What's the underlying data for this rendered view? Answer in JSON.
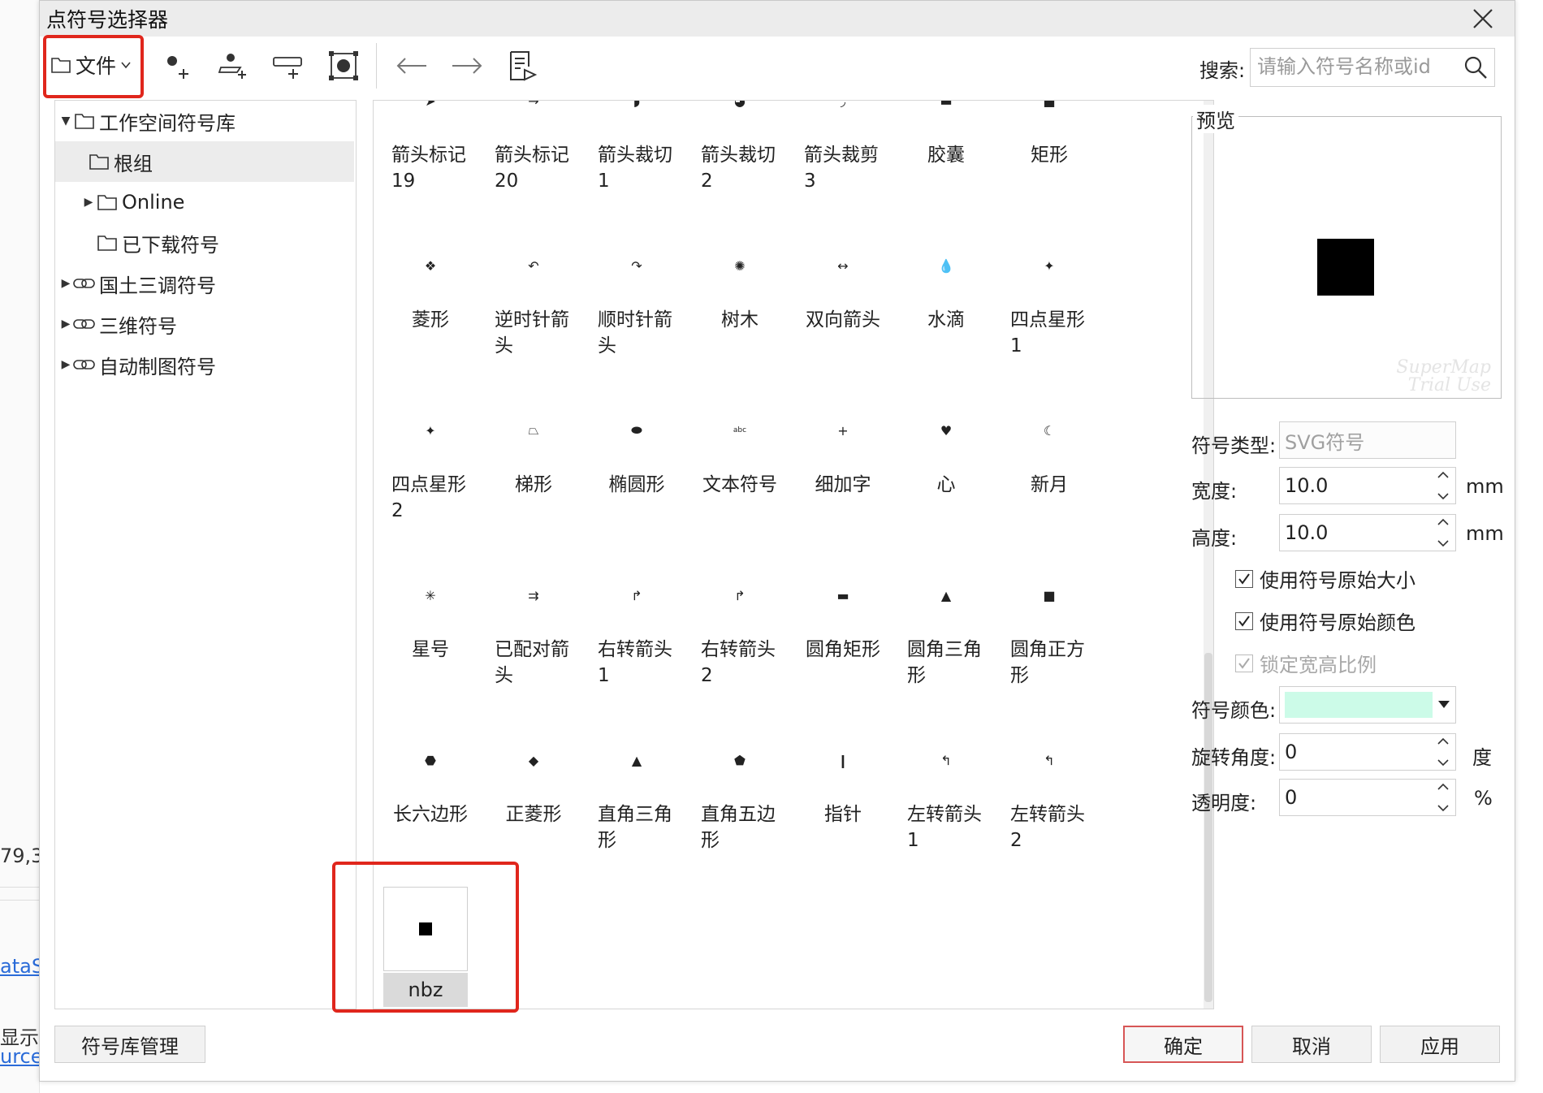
{
  "background_app": {
    "coord_text": "79,3",
    "link1": "ataS",
    "show_text": "显示",
    "link2": "urce"
  },
  "dialog": {
    "title": "点符号选择器",
    "toolbar": {
      "file_label": "文件",
      "search_label": "搜索:",
      "search_placeholder": "请输入符号名称或id"
    },
    "tree": [
      {
        "label": "工作空间符号库",
        "icon": "folder-icon",
        "expanded": true
      },
      {
        "label": "根组",
        "icon": "folder-icon",
        "selected": true
      },
      {
        "label": "Online",
        "icon": "folder-icon",
        "expanded": false
      },
      {
        "label": "已下载符号",
        "icon": "folder-icon"
      },
      {
        "label": "国土三调符号",
        "icon": "link-icon",
        "expanded": false
      },
      {
        "label": "三维符号",
        "icon": "link-icon",
        "expanded": false
      },
      {
        "label": "自动制图符号",
        "icon": "link-icon",
        "expanded": false
      }
    ],
    "symbols": [
      {
        "label": "箭头标记19",
        "glyph": "➤"
      },
      {
        "label": "箭头标记20",
        "glyph": "→"
      },
      {
        "label": "箭头裁切1",
        "glyph": "◗"
      },
      {
        "label": "箭头裁切2",
        "glyph": "◕"
      },
      {
        "label": "箭头裁剪3",
        "glyph": "◞"
      },
      {
        "label": "胶囊",
        "glyph": "▬"
      },
      {
        "label": "矩形",
        "glyph": "■"
      },
      {
        "label": "菱形",
        "glyph": "❖"
      },
      {
        "label": "逆时针箭头",
        "glyph": "↶"
      },
      {
        "label": "顺时针箭头",
        "glyph": "↷"
      },
      {
        "label": "树木",
        "glyph": "✺"
      },
      {
        "label": "双向箭头",
        "glyph": "↔"
      },
      {
        "label": "水滴",
        "glyph": "💧"
      },
      {
        "label": "四点星形1",
        "glyph": "✦"
      },
      {
        "label": "四点星形2",
        "glyph": "✦"
      },
      {
        "label": "梯形",
        "glyph": "⏢"
      },
      {
        "label": "椭圆形",
        "glyph": "⬬"
      },
      {
        "label": "文本符号",
        "glyph": "abc"
      },
      {
        "label": "细加字",
        "glyph": "+"
      },
      {
        "label": "心",
        "glyph": "♥"
      },
      {
        "label": "新月",
        "glyph": "☾"
      },
      {
        "label": "星号",
        "glyph": "✳"
      },
      {
        "label": "已配对箭头",
        "glyph": "⇉"
      },
      {
        "label": "右转箭头1",
        "glyph": "↱"
      },
      {
        "label": "右转箭头2",
        "glyph": "↱"
      },
      {
        "label": "圆角矩形",
        "glyph": "▬"
      },
      {
        "label": "圆角三角形",
        "glyph": "▲"
      },
      {
        "label": "圆角正方形",
        "glyph": "■"
      },
      {
        "label": "长六边形",
        "glyph": "⬣"
      },
      {
        "label": "正菱形",
        "glyph": "◆"
      },
      {
        "label": "直角三角形",
        "glyph": "▲"
      },
      {
        "label": "直角五边形",
        "glyph": "⬟"
      },
      {
        "label": "指针",
        "glyph": "❙"
      },
      {
        "label": "左转箭头1",
        "glyph": "↰"
      },
      {
        "label": "左转箭头2",
        "glyph": "↰"
      }
    ],
    "custom_symbol": {
      "label": "nbz"
    },
    "preview": {
      "legend": "预览",
      "watermark_line1": "SuperMap",
      "watermark_line2": "Trial Use"
    },
    "properties": {
      "type_label": "符号类型:",
      "type_value": "SVG符号",
      "width_label": "宽度:",
      "width_value": "10.0",
      "width_unit": "mm",
      "height_label": "高度:",
      "height_value": "10.0",
      "height_unit": "mm",
      "use_original_size": {
        "label": "使用符号原始大小",
        "checked": true
      },
      "use_original_color": {
        "label": "使用符号原始颜色",
        "checked": true
      },
      "lock_ratio": {
        "label": "锁定宽高比例",
        "checked": true,
        "disabled": true
      },
      "color_label": "符号颜色:",
      "color_value": "#ccfbe8",
      "rotation_label": "旋转角度:",
      "rotation_value": "0",
      "rotation_unit": "度",
      "opacity_label": "透明度:",
      "opacity_value": "0",
      "opacity_unit": "%"
    },
    "buttons": {
      "library_manage": "符号库管理",
      "ok": "确定",
      "cancel": "取消",
      "apply": "应用"
    },
    "colors": {
      "highlight_red": "#e0261c",
      "primary_border": "#d75656"
    }
  }
}
